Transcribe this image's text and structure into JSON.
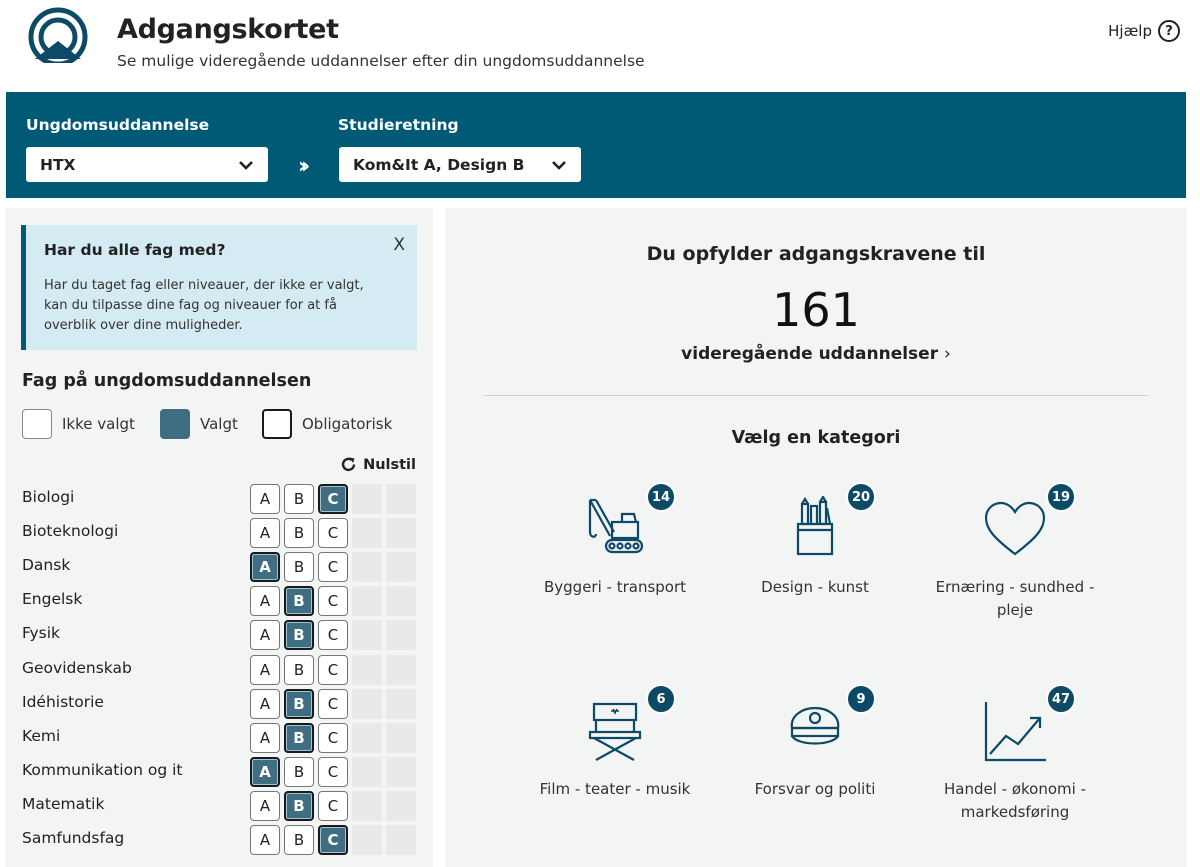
{
  "header": {
    "title": "Adgangskortet",
    "subtitle": "Se mulige videregående uddannelser efter din ungdomsuddannelse",
    "help_label": "Hjælp",
    "help_icon": "question-circle-icon"
  },
  "filters": {
    "education_label": "Ungdomsuddannelse",
    "education_value": "HTX",
    "direction_label": "Studieretning",
    "direction_value": "Kom&It A, Design B",
    "arrow_icon": "double-chevron-right-icon"
  },
  "info": {
    "title": "Har du alle fag med?",
    "text": "Har du taget fag eller niveauer, der ikke er valgt, kan du tilpasse dine fag og niveauer for at få overblik over dine muligheder.",
    "close_label": "X"
  },
  "subjects_panel": {
    "title": "Fag på ungdomsuddannelsen",
    "legend": {
      "not_selected": "Ikke valgt",
      "selected": "Valgt",
      "mandatory": "Obligatorisk"
    },
    "reset_label": "Nulstil",
    "levels": [
      "A",
      "B",
      "C"
    ],
    "subjects": [
      {
        "name": "Biologi",
        "selected": "C"
      },
      {
        "name": "Bioteknologi",
        "selected": ""
      },
      {
        "name": "Dansk",
        "selected": "A"
      },
      {
        "name": "Engelsk",
        "selected": "B"
      },
      {
        "name": "Fysik",
        "selected": "B"
      },
      {
        "name": "Geovidenskab",
        "selected": ""
      },
      {
        "name": "Idéhistorie",
        "selected": "B"
      },
      {
        "name": "Kemi",
        "selected": "B"
      },
      {
        "name": "Kommunikation og it",
        "selected": "A"
      },
      {
        "name": "Matematik",
        "selected": "B"
      },
      {
        "name": "Samfundsfag",
        "selected": "C"
      }
    ]
  },
  "results": {
    "heading": "Du opfylder adgangskravene til",
    "count": "161",
    "link_label": "videregående uddannelser",
    "category_title": "Vælg en kategori",
    "categories": [
      {
        "label": "Byggeri - transport",
        "count": "14",
        "icon": "crane-icon"
      },
      {
        "label": "Design - kunst",
        "count": "20",
        "icon": "pencil-cup-icon"
      },
      {
        "label": "Ernæring - sundhed - pleje",
        "count": "19",
        "icon": "heart-icon"
      },
      {
        "label": "Film - teater - musik",
        "count": "6",
        "icon": "directors-chair-icon"
      },
      {
        "label": "Forsvar og politi",
        "count": "9",
        "icon": "police-cap-icon"
      },
      {
        "label": "Handel - økonomi - markedsføring",
        "count": "47",
        "icon": "trend-chart-icon"
      }
    ]
  },
  "colors": {
    "brand": "#005a76",
    "selected": "#3f6e83",
    "badge": "#0d4a66",
    "info_bg": "#d4ebf3"
  }
}
